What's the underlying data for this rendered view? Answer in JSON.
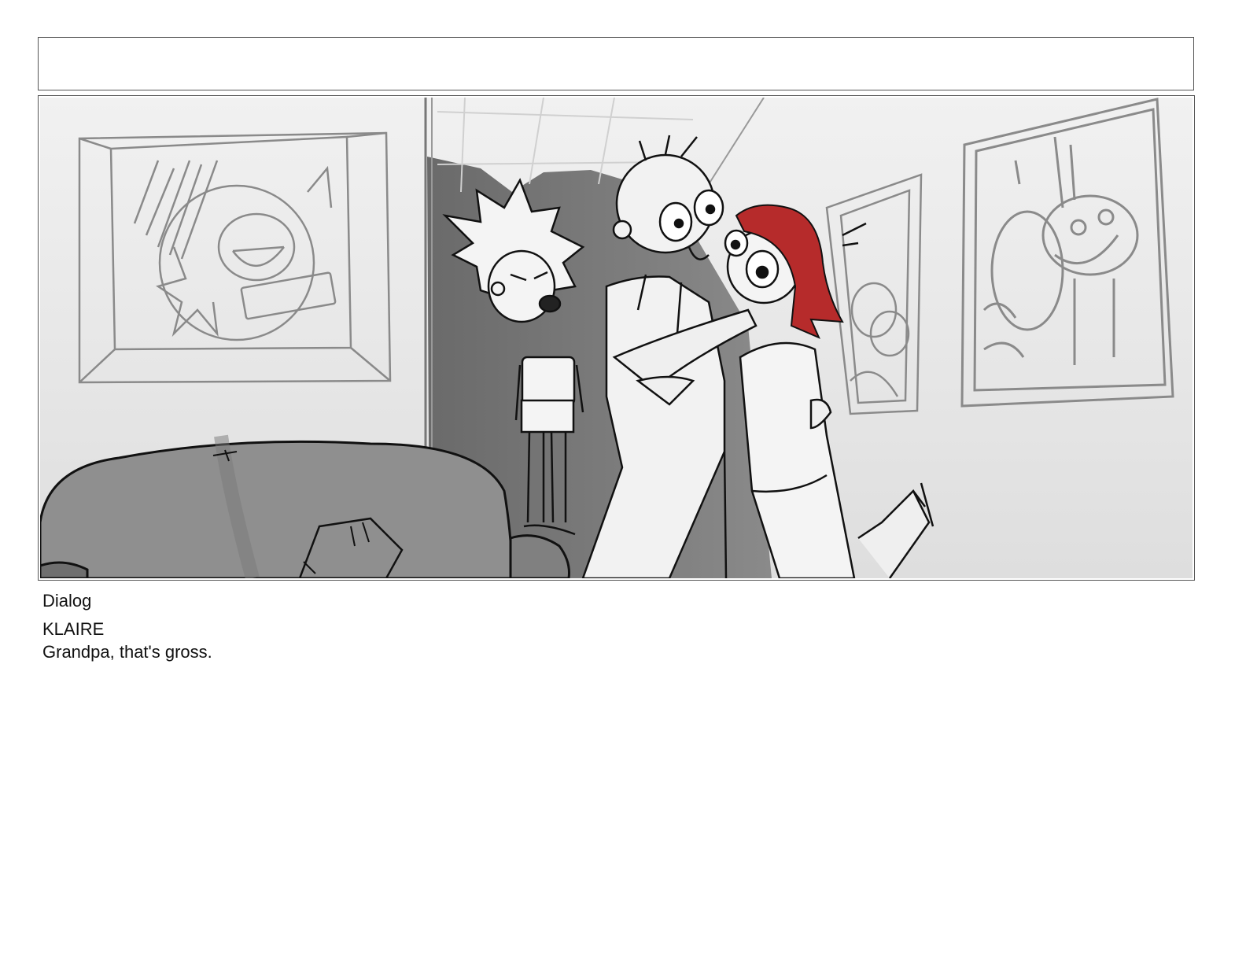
{
  "header": {
    "note": ""
  },
  "panel": {
    "image_alt": "Storyboard panel: a spiky-haired child glaring while an elderly man hugs a red-haired woman in a gallery room",
    "accent_red": "#b62b2b"
  },
  "dialog": {
    "heading": "Dialog",
    "speaker": "KLAIRE",
    "line": "Grandpa, that's gross."
  }
}
